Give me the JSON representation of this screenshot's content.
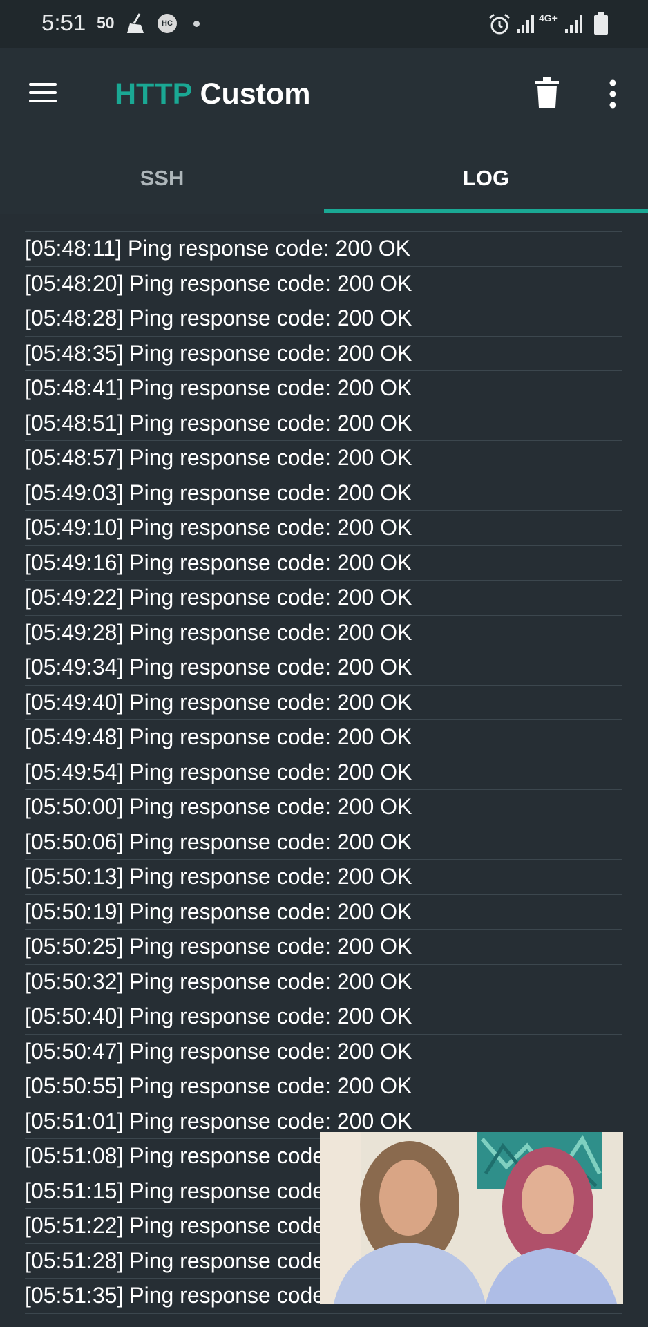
{
  "status_bar": {
    "time": "5:51",
    "indicator": "50",
    "hc_badge": "HC",
    "network": "4G+"
  },
  "app_bar": {
    "title_accent": "HTTP",
    "title_rest": "Custom",
    "accent_color": "#1aa894"
  },
  "tabs": [
    {
      "label": "SSH",
      "active": false
    },
    {
      "label": "LOG",
      "active": true
    }
  ],
  "log": {
    "entries": [
      "[05:48:11] Ping response code: 200 OK",
      "[05:48:20] Ping response code: 200 OK",
      "[05:48:28] Ping response code: 200 OK",
      "[05:48:35] Ping response code: 200 OK",
      "[05:48:41] Ping response code: 200 OK",
      "[05:48:51] Ping response code: 200 OK",
      "[05:48:57] Ping response code: 200 OK",
      "[05:49:03] Ping response code: 200 OK",
      "[05:49:10] Ping response code: 200 OK",
      "[05:49:16] Ping response code: 200 OK",
      "[05:49:22] Ping response code: 200 OK",
      "[05:49:28] Ping response code: 200 OK",
      "[05:49:34] Ping response code: 200 OK",
      "[05:49:40] Ping response code: 200 OK",
      "[05:49:48] Ping response code: 200 OK",
      "[05:49:54] Ping response code: 200 OK",
      "[05:50:00] Ping response code: 200 OK",
      "[05:50:06] Ping response code: 200 OK",
      "[05:50:13] Ping response code: 200 OK",
      "[05:50:19] Ping response code: 200 OK",
      "[05:50:25] Ping response code: 200 OK",
      "[05:50:32] Ping response code: 200 OK",
      "[05:50:40] Ping response code: 200 OK",
      "[05:50:47] Ping response code: 200 OK",
      "[05:50:55] Ping response code: 200 OK",
      "[05:51:01] Ping response code: 200 OK",
      "[05:51:08] Ping response code: 200 OK",
      "[05:51:15] Ping response code: 200 OK",
      "[05:51:22] Ping response code: 200 OK",
      "[05:51:28] Ping response code: 200 OK",
      "[05:51:35] Ping response code: 200 OK"
    ]
  },
  "icons": {
    "menu": "hamburger-menu-icon",
    "delete": "trash-icon",
    "more": "more-vert-icon"
  }
}
